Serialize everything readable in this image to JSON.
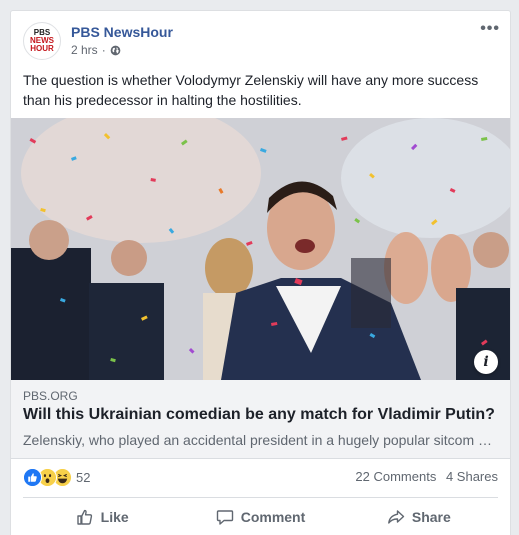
{
  "post": {
    "page_name": "PBS NewsHour",
    "timestamp": "2 hrs",
    "privacy_icon": "globe-icon",
    "logo": {
      "line1": "PBS",
      "line2": "NEWS",
      "line3": "HOUR"
    },
    "text": "The question is whether Volodymyr Zelenskiy will have any more success than his predecessor in halting the hostilities."
  },
  "link_preview": {
    "domain": "PBS.ORG",
    "title": "Will this Ukrainian comedian be any match for Vladimir Putin?",
    "description": "Zelenskiy, who played an accidental president in a hugely popular sitcom …"
  },
  "stats": {
    "reaction_count": "52",
    "comments": "22 Comments",
    "shares": "4 Shares"
  },
  "actions": {
    "like": "Like",
    "comment": "Comment",
    "share": "Share"
  },
  "colors": {
    "page_name": "#365899",
    "like_blue": "#2078f4",
    "emoji_yellow": "#f7d04a",
    "logo_red": "#c4161c"
  }
}
